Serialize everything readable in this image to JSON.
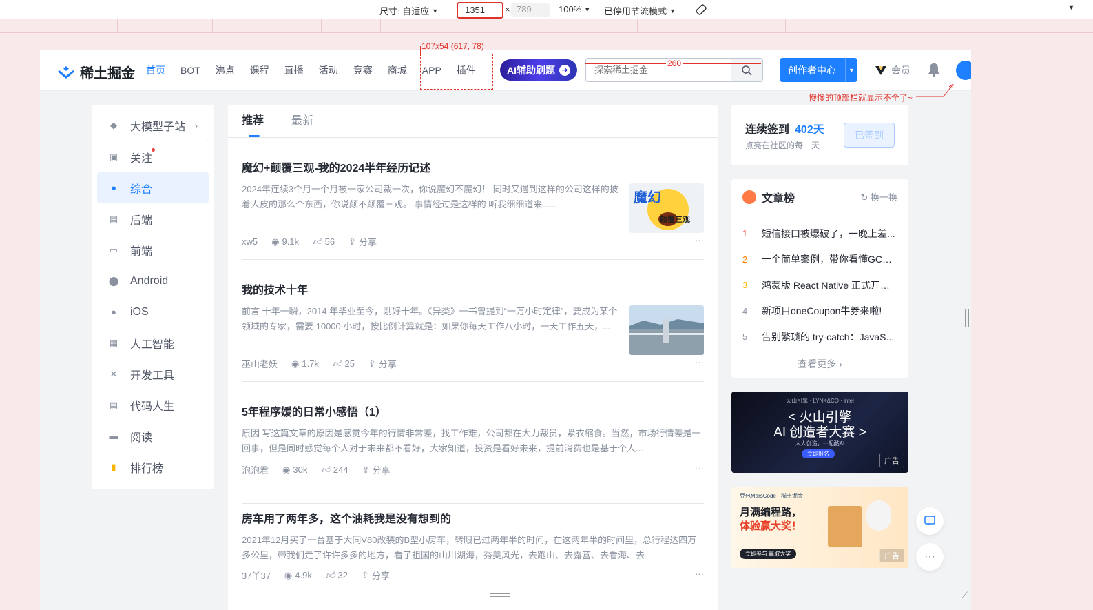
{
  "devtools": {
    "size_label": "尺寸: 自适应",
    "width": "1351",
    "times": "×",
    "height_placeholder": "789",
    "zoom": "100%",
    "throttle": "已停用节流模式"
  },
  "annotations": {
    "nav_box": "107x54 (617, 78)",
    "search_width": "260",
    "note": "慢慢的顶部栏就显示不全了~"
  },
  "header": {
    "logo_text": "稀土掘金",
    "nav": [
      "首页",
      "BOT",
      "沸点",
      "课程",
      "直播",
      "活动",
      "竞赛",
      "商城",
      "APP",
      "插件"
    ],
    "active_nav": "首页",
    "ai_button": "AI辅助刷题",
    "search_placeholder": "探索稀土掘金",
    "creator_button": "创作者中心",
    "vip_label": "会员"
  },
  "sidebar": {
    "items": [
      {
        "label": "大模型子站",
        "icon": "cube-icon"
      },
      {
        "label": "关注",
        "icon": "follow-icon"
      },
      {
        "label": "综合",
        "icon": "compass-icon"
      },
      {
        "label": "后端",
        "icon": "backend-icon"
      },
      {
        "label": "前端",
        "icon": "frontend-icon"
      },
      {
        "label": "Android",
        "icon": "android-icon"
      },
      {
        "label": "iOS",
        "icon": "apple-icon"
      },
      {
        "label": "人工智能",
        "icon": "robot-icon"
      },
      {
        "label": "开发工具",
        "icon": "tools-icon"
      },
      {
        "label": "代码人生",
        "icon": "code-life-icon"
      },
      {
        "label": "阅读",
        "icon": "reading-icon"
      },
      {
        "label": "排行榜",
        "icon": "ranking-icon"
      }
    ],
    "active": "综合"
  },
  "feed": {
    "tabs": [
      "推荐",
      "最新"
    ],
    "active_tab": "推荐",
    "articles": [
      {
        "title": "魔幻+颠覆三观-我的2024半年经历记述",
        "desc": "2024年连续3个月一个月被一家公司裁一次，你说魔幻不魔幻！ 同时又遇到这样的公司这样的披着人皮的那么个东西，你说颠不颠覆三观。 事情经过是这样的 听我细细道来......",
        "author": "xw5",
        "views": "9.1k",
        "likes": "56",
        "share": "分享",
        "thumb_text": "魔幻",
        "thumb_sub": "颠覆三观"
      },
      {
        "title": "我的技术十年",
        "desc": "前言 十年一瞬，2014 年毕业至今，刚好十年。《异类》一书曾提到“一万小时定律”，要成为某个领域的专家，需要 10000 小时，按比例计算就是：如果你每天工作八小时，一天工作五天，...",
        "author": "巫山老妖",
        "views": "1.7k",
        "likes": "25",
        "share": "分享"
      },
      {
        "title": "5年程序媛的日常小感悟（1）",
        "desc": "原因 写这篇文章的原因是感觉今年的行情非常差，找工作难，公司都在大力裁员，紧衣缩食。当然，市场行情差是一回事，但是同时感觉每个人对于未来都不看好，大家知道，投资是看好未来，提前消费也是基于个人...",
        "author": "泡泡君",
        "views": "30k",
        "likes": "244",
        "share": "分享"
      },
      {
        "title": "房车用了两年多，这个油耗我是没有想到的",
        "desc": "2021年12月买了一台基于大同V80改装的B型小房车，转眼已过两年半的时间，在这两年半的时间里，总行程达四万多公里，带我们走了许许多多的地方，看了祖国的山川湖海，秀美风光，去跑山、去露营、去看海、去",
        "author": "37丫37",
        "views": "4.9k",
        "likes": "32",
        "share": "分享"
      }
    ],
    "more": "···"
  },
  "signin": {
    "title": "连续签到",
    "days": "402天",
    "sub": "点亮在社区的每一天",
    "button": "已签到"
  },
  "rank": {
    "title": "文章榜",
    "swap": "换一换",
    "items": [
      {
        "n": "1",
        "t": "短信接口被爆破了，一晚上差..."
      },
      {
        "n": "2",
        "t": "一个简单案例，带你看懂GC日..."
      },
      {
        "n": "3",
        "t": "鸿蒙版 React Native 正式开源..."
      },
      {
        "n": "4",
        "t": "新项目oneCoupon牛券来啦!"
      },
      {
        "n": "5",
        "t": "告别繁琐的 try-catch：JavaS..."
      }
    ],
    "more": "查看更多 ›"
  },
  "ads": [
    {
      "l1": "< 火山引擎",
      "l2": "AI 创造者大赛 >",
      "l3": "人人创造，一起酷AI",
      "btn": "立即报名",
      "tag": "广告",
      "top": "火山引擎 · LYNK&CO · intel"
    },
    {
      "l1": "月满编程路，",
      "l2": "体验赢大奖！",
      "top": "豆包MarsCode · 稀土掘金",
      "btn": "立即参与 赢取大奖",
      "tag": "广告"
    }
  ],
  "colors": {
    "brand": "#1e80ff",
    "annotation": "#e0332b"
  }
}
